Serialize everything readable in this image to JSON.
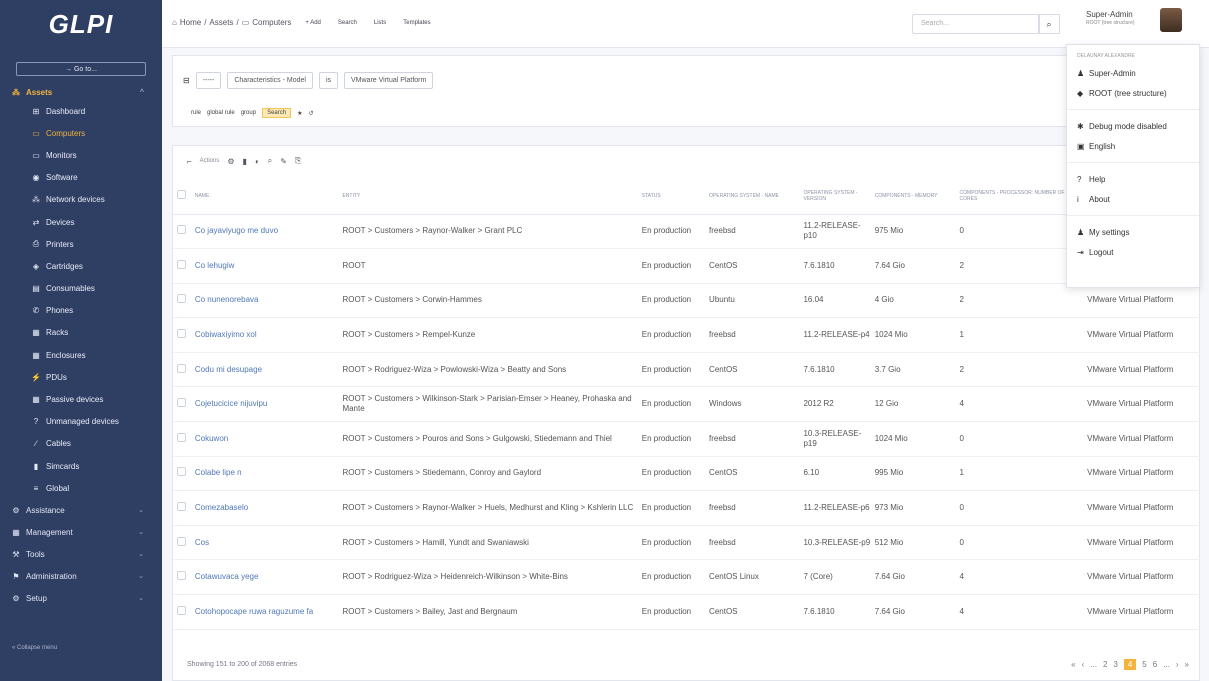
{
  "app": {
    "logo": "GLPI"
  },
  "sidebar": {
    "goto": "→ Go to...",
    "assets_label": "Assets",
    "items": [
      {
        "icon": "⊞",
        "label": "Dashboard"
      },
      {
        "icon": "▭",
        "label": "Computers"
      },
      {
        "icon": "▭",
        "label": "Monitors"
      },
      {
        "icon": "◉",
        "label": "Software"
      },
      {
        "icon": "⁂",
        "label": "Network devices"
      },
      {
        "icon": "⇄",
        "label": "Devices"
      },
      {
        "icon": "⎙",
        "label": "Printers"
      },
      {
        "icon": "◈",
        "label": "Cartridges"
      },
      {
        "icon": "▤",
        "label": "Consumables"
      },
      {
        "icon": "✆",
        "label": "Phones"
      },
      {
        "icon": "▦",
        "label": "Racks"
      },
      {
        "icon": "▦",
        "label": "Enclosures"
      },
      {
        "icon": "⚡",
        "label": "PDUs"
      },
      {
        "icon": "▦",
        "label": "Passive devices"
      },
      {
        "icon": "?",
        "label": "Unmanaged devices"
      },
      {
        "icon": "∕",
        "label": "Cables"
      },
      {
        "icon": "▮",
        "label": "Simcards"
      },
      {
        "icon": "≡",
        "label": "Global"
      }
    ],
    "sections": [
      {
        "icon": "⚙",
        "label": "Assistance"
      },
      {
        "icon": "▦",
        "label": "Management"
      },
      {
        "icon": "⚒",
        "label": "Tools"
      },
      {
        "icon": "⚑",
        "label": "Administration"
      },
      {
        "icon": "⚙",
        "label": "Setup"
      }
    ],
    "collapse": "« Collapse menu"
  },
  "topbar": {
    "breadcrumb": [
      "Home",
      "Assets",
      "Computers"
    ],
    "tools": [
      "+ Add",
      "Search",
      "Lists",
      "Templates"
    ],
    "search_placeholder": "Search...",
    "user_name": "Super-Admin",
    "user_entity": "ROOT (tree structure)"
  },
  "criteria": {
    "dash": "-----",
    "field": "Characteristics - Model",
    "op": "is",
    "value": "VMware Virtual Platform",
    "actions": [
      "rule",
      "global rule",
      "group",
      "Search"
    ]
  },
  "list": {
    "actions_label": "Actions",
    "columns": [
      "Name",
      "Entity",
      "Status",
      "Operating system - Name",
      "Operating system - Version",
      "Components - Memory",
      "Components - Processor: number of cores",
      ""
    ],
    "rows": [
      [
        "Co jayaviyugo me duvo",
        "ROOT > Customers > Raynor-Walker > Grant PLC",
        "En production",
        "freebsd",
        "11.2-RELEASE-p10",
        "975 Mio",
        "0",
        ""
      ],
      [
        "Co lehugiw",
        "ROOT",
        "En production",
        "CentOS",
        "7.6.1810",
        "7.64 Gio",
        "2",
        ""
      ],
      [
        "Co nunenorebava",
        "ROOT > Customers > Corwin-Hammes",
        "En production",
        "Ubuntu",
        "16.04",
        "4 Gio",
        "2",
        "VMware Virtual Platform"
      ],
      [
        "Cobiwaxiyimo xol",
        "ROOT > Customers > Rempel-Kunze",
        "En production",
        "freebsd",
        "11.2-RELEASE-p4",
        "1024 Mio",
        "1",
        "VMware Virtual Platform"
      ],
      [
        "Codu mi desupage",
        "ROOT > Rodriguez-Wiza > Powlowski-Wiza > Beatty and Sons",
        "En production",
        "CentOS",
        "7.6.1810",
        "3.7 Gio",
        "2",
        "VMware Virtual Platform"
      ],
      [
        "Cojetucicice nijuvipu",
        "ROOT > Customers > Wilkinson-Stark > Parisian-Emser > Heaney, Prohaska and Mante",
        "En production",
        "Windows",
        "2012 R2",
        "12 Gio",
        "4",
        "VMware Virtual Platform"
      ],
      [
        "Cokuwon",
        "ROOT > Customers > Pouros and Sons > Gulgowski, Stiedemann and Thiel",
        "En production",
        "freebsd",
        "10.3-RELEASE-p19",
        "1024 Mio",
        "0",
        "VMware Virtual Platform"
      ],
      [
        "Colabe lipe n",
        "ROOT > Customers > Stiedemann, Conroy and Gaylord",
        "En production",
        "CentOS",
        "6.10",
        "995 Mio",
        "1",
        "VMware Virtual Platform"
      ],
      [
        "Comezabaselo",
        "ROOT > Customers > Raynor-Walker > Huels, Medhurst and Kling > Kshlerin LLC",
        "En production",
        "freebsd",
        "11.2-RELEASE-p6",
        "973 Mio",
        "0",
        "VMware Virtual Platform"
      ],
      [
        "Cos",
        "ROOT > Customers > Hamill, Yundt and Swaniawski",
        "En production",
        "freebsd",
        "10.3-RELEASE-p9",
        "512 Mio",
        "0",
        "VMware Virtual Platform"
      ],
      [
        "Cotawuvaca yege",
        "ROOT > Rodriguez-Wiza > Heidenreich-Wilkinson > White-Bins",
        "En production",
        "CentOS Linux",
        "7 (Core)",
        "7.64 Gio",
        "4",
        "VMware Virtual Platform"
      ],
      [
        "Cotohopocape ruwa raguzume fa",
        "ROOT > Customers > Bailey, Jast and Bergnaum",
        "En production",
        "CentOS",
        "7.6.1810",
        "7.64 Gio",
        "4",
        "VMware Virtual Platform"
      ]
    ],
    "showing": "Showing 151 to 200 of 2068 entries",
    "pager": [
      "«",
      "‹",
      "...",
      "2",
      "3",
      "4",
      "5",
      "6",
      "...",
      "›",
      "»"
    ],
    "current_page": "4"
  },
  "dropdown": {
    "header": "DELAUNAY ALEXANDRE",
    "items": [
      {
        "icon": "♟",
        "label": "Super-Admin"
      },
      {
        "icon": "◆",
        "label": "ROOT (tree structure)"
      },
      {
        "icon": "✱",
        "label": "Debug mode disabled"
      },
      {
        "icon": "▣",
        "label": "English"
      },
      {
        "icon": "?",
        "label": "Help"
      },
      {
        "icon": "i",
        "label": "About"
      },
      {
        "icon": "♟",
        "label": "My settings"
      },
      {
        "icon": "⇥",
        "label": "Logout"
      }
    ]
  }
}
